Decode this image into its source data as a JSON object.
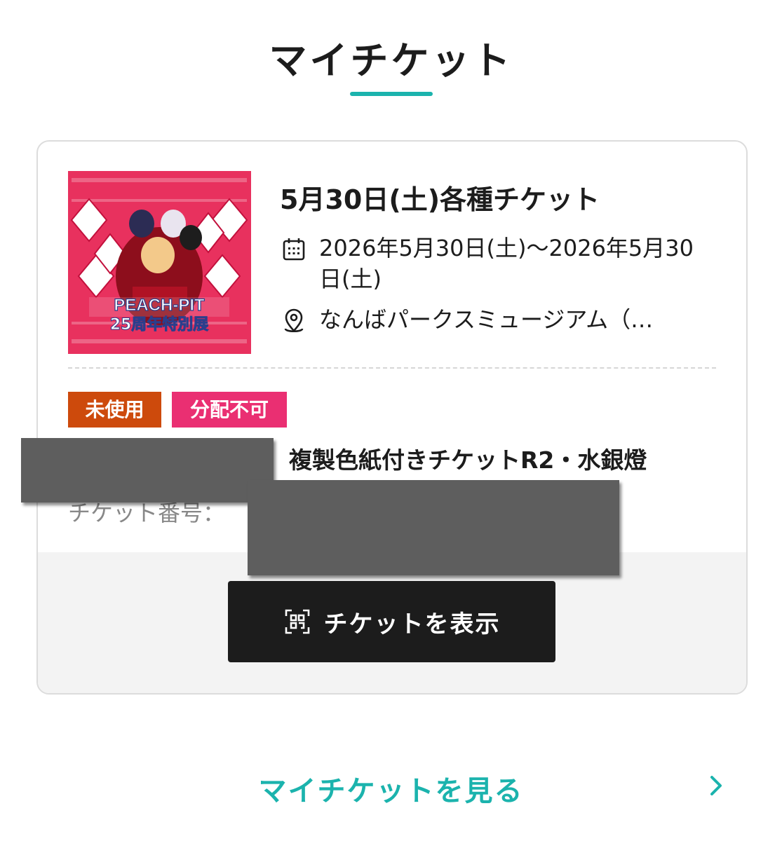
{
  "header": {
    "title": "マイチケット"
  },
  "event": {
    "thumbnail_text_line1": "PEACH-PIT",
    "thumbnail_text_line2": "25周年特別展",
    "title": "5月30日(土)各種チケット",
    "date_icon": "calendar-icon",
    "date_range": "2026年5月30日(土)〜2026年5月30日(土)",
    "venue_icon": "location-pin-icon",
    "venue": "なんばパークスミュージアム（…"
  },
  "ticket": {
    "status_badge": "未使用",
    "transfer_badge": "分配不可",
    "name": "複製色紙付きチケットR2・水銀燈",
    "number_label": "チケット番号："
  },
  "actions": {
    "show_ticket_icon": "qr-code-icon",
    "show_ticket_label": "チケットを表示"
  },
  "footer": {
    "see_more_label": "マイチケットを見る",
    "see_more_icon": "chevron-right-icon"
  },
  "colors": {
    "accent": "#1bb3ad",
    "unused_badge": "#cd4a0c",
    "nontransfer_badge": "#ea2f72",
    "button_bg": "#1c1c1c",
    "thumbnail_bg": "#e8315e"
  }
}
